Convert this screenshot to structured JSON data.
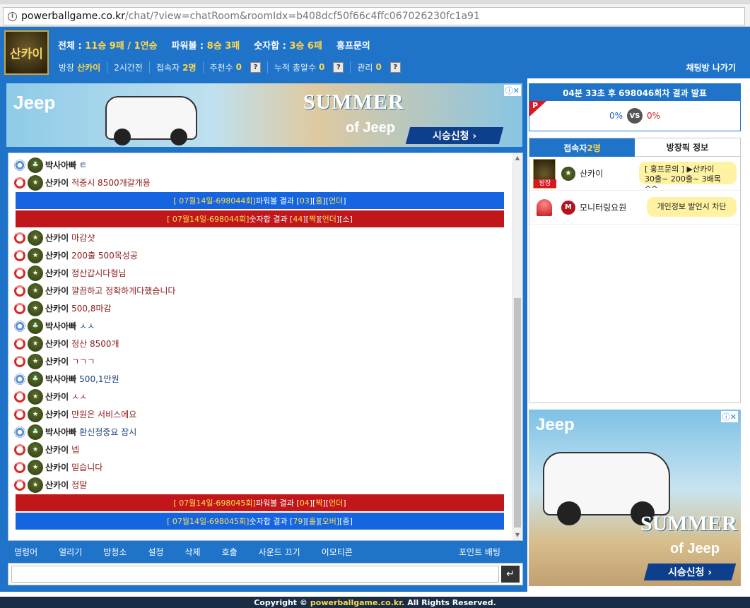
{
  "browser": {
    "url_host": "powerballgame.co.kr",
    "url_path": "/chat/?view=chatRoom&roomIdx=b408dcf50f66c4ffc067026230fc1a91"
  },
  "header": {
    "logo_text": "산카이",
    "stats": [
      {
        "label": "전체 : ",
        "value": "11승 9패 / 1연승"
      },
      {
        "label": "파워볼 : ",
        "value": "8승 3패"
      },
      {
        "label": "숫자합 : ",
        "value": "3승 6패"
      }
    ],
    "promo": "홍프문의",
    "sub": {
      "room_label": "방장",
      "room_owner": "산카이",
      "time": "2시간전",
      "users_label": "접속자",
      "users_count": "2명",
      "recommend_label": "추천수",
      "recommend_count": "0",
      "total_rec_label": "누적 총알수",
      "total_rec_count": "0",
      "manage_label": "관리",
      "manage_count": "0",
      "help": "?"
    },
    "leave_button": "채팅방 나가기"
  },
  "ad_top": {
    "brand": "Jeep",
    "headline": "SUMMER",
    "sub": "of Jeep",
    "cta": "시승신청 ›"
  },
  "chat": {
    "messages": [
      {
        "kind": "msg",
        "lvl": "blue",
        "nick": "박사아빠",
        "text": "ㅌ",
        "tone": "blue"
      },
      {
        "kind": "msg",
        "lvl": "red",
        "nick": "산카이",
        "text": "적중시 8500개갈개용",
        "tone": "red"
      },
      {
        "kind": "result",
        "color": "blue",
        "pre": "[ 07월14일-698044회]",
        "mid": " 파워볼 결과 [",
        "val": "03",
        "post": "][",
        "t1": "홀",
        "sep": "][",
        "t2": "언더",
        "end": "]"
      },
      {
        "kind": "result",
        "color": "red",
        "pre": "[ 07월14일-698044회]",
        "mid": " 숫자합 결과 [",
        "val": "44",
        "post": "][",
        "t1": "짝",
        "sep": "][",
        "t2": "언더",
        "end": "][소]"
      },
      {
        "kind": "msg",
        "lvl": "red",
        "nick": "산카이",
        "text": "마감샷",
        "tone": "red"
      },
      {
        "kind": "msg",
        "lvl": "red",
        "nick": "산카이",
        "text": "200출 500목성공",
        "tone": "red"
      },
      {
        "kind": "msg",
        "lvl": "red",
        "nick": "산카이",
        "text": "정산갑시다형님",
        "tone": "red"
      },
      {
        "kind": "msg",
        "lvl": "red",
        "nick": "산카이",
        "text": "깔끔하고 정확하게다했습니다",
        "tone": "red"
      },
      {
        "kind": "msg",
        "lvl": "red",
        "nick": "산카이",
        "text": "500,8마감",
        "tone": "red"
      },
      {
        "kind": "msg",
        "lvl": "blue",
        "nick": "박사아빠",
        "text": "ㅅㅅ",
        "tone": "blue"
      },
      {
        "kind": "msg",
        "lvl": "red",
        "nick": "산카이",
        "text": "정산 8500개",
        "tone": "red"
      },
      {
        "kind": "msg",
        "lvl": "red",
        "nick": "산카이",
        "text": "ㄱㄱㄱ",
        "tone": "red"
      },
      {
        "kind": "msg",
        "lvl": "blue",
        "nick": "박사아빠",
        "text": "500,1만원",
        "tone": "blue"
      },
      {
        "kind": "msg",
        "lvl": "red",
        "nick": "산카이",
        "text": "ㅅㅅ",
        "tone": "red"
      },
      {
        "kind": "msg",
        "lvl": "red",
        "nick": "산카이",
        "text": "만원은 서비스에요",
        "tone": "red"
      },
      {
        "kind": "msg",
        "lvl": "blue",
        "nick": "박사아빠",
        "text": "환신청중요 잠시",
        "tone": "blue"
      },
      {
        "kind": "msg",
        "lvl": "red",
        "nick": "산카이",
        "text": "넵",
        "tone": "red"
      },
      {
        "kind": "msg",
        "lvl": "red",
        "nick": "산카이",
        "text": "믿습니다",
        "tone": "red"
      },
      {
        "kind": "msg",
        "lvl": "red",
        "nick": "산카이",
        "text": "정말",
        "tone": "red"
      },
      {
        "kind": "result",
        "color": "red",
        "pre": "[ 07월14일-698045회]",
        "mid": " 파워볼 결과 [",
        "val": "04",
        "post": "][",
        "t1": "짝",
        "sep": "][",
        "t2": "언더",
        "end": "]"
      },
      {
        "kind": "result",
        "color": "blue",
        "pre": "[ 07월14일-698045회]",
        "mid": " 숫자합 결과 [",
        "val": "79",
        "post": "][",
        "t1": "홀",
        "sep": "][",
        "t2": "오버",
        "end": "][중]"
      }
    ]
  },
  "toolbar": {
    "items": [
      "명령어",
      "얼리기",
      "방청소",
      "설정",
      "삭제",
      "호출",
      "사운드 끄기",
      "이모티콘"
    ],
    "point": "포인트 배팅"
  },
  "input": {
    "placeholder": "",
    "send": "↵"
  },
  "announce": {
    "title": "04분 33초 후 698046회차 결과 발표",
    "flag": "P",
    "left_pct": "0%",
    "vs": "VS",
    "right_pct": "0%"
  },
  "users": {
    "tab_users_label": "접속자 ",
    "tab_users_count": "2명",
    "tab_info": "방장픽 정보",
    "list": [
      {
        "name": "산카이",
        "tag": "방장",
        "bubble_line1": "[ 홍프문의 ] ▶산카이",
        "bubble_line2": "30출~ 200출~ 3배목 ^^"
      },
      {
        "name": "모니터링요원",
        "badge": "M",
        "bubble": "개인정보 발언시 차단"
      }
    ]
  },
  "ad_right": {
    "brand": "Jeep",
    "headline": "SUMMER",
    "sub": "of Jeep",
    "cta": "시승신청 ›"
  },
  "footer": {
    "pre": "Copyright ©",
    "site": "powerballgame.co.kr.",
    "post": "All Rights Reserved."
  },
  "colors": {
    "primary_blue": "#1f74c9",
    "result_blue": "#1565e0",
    "result_red": "#c1161a",
    "highlight_yellow": "#ffd84a"
  }
}
